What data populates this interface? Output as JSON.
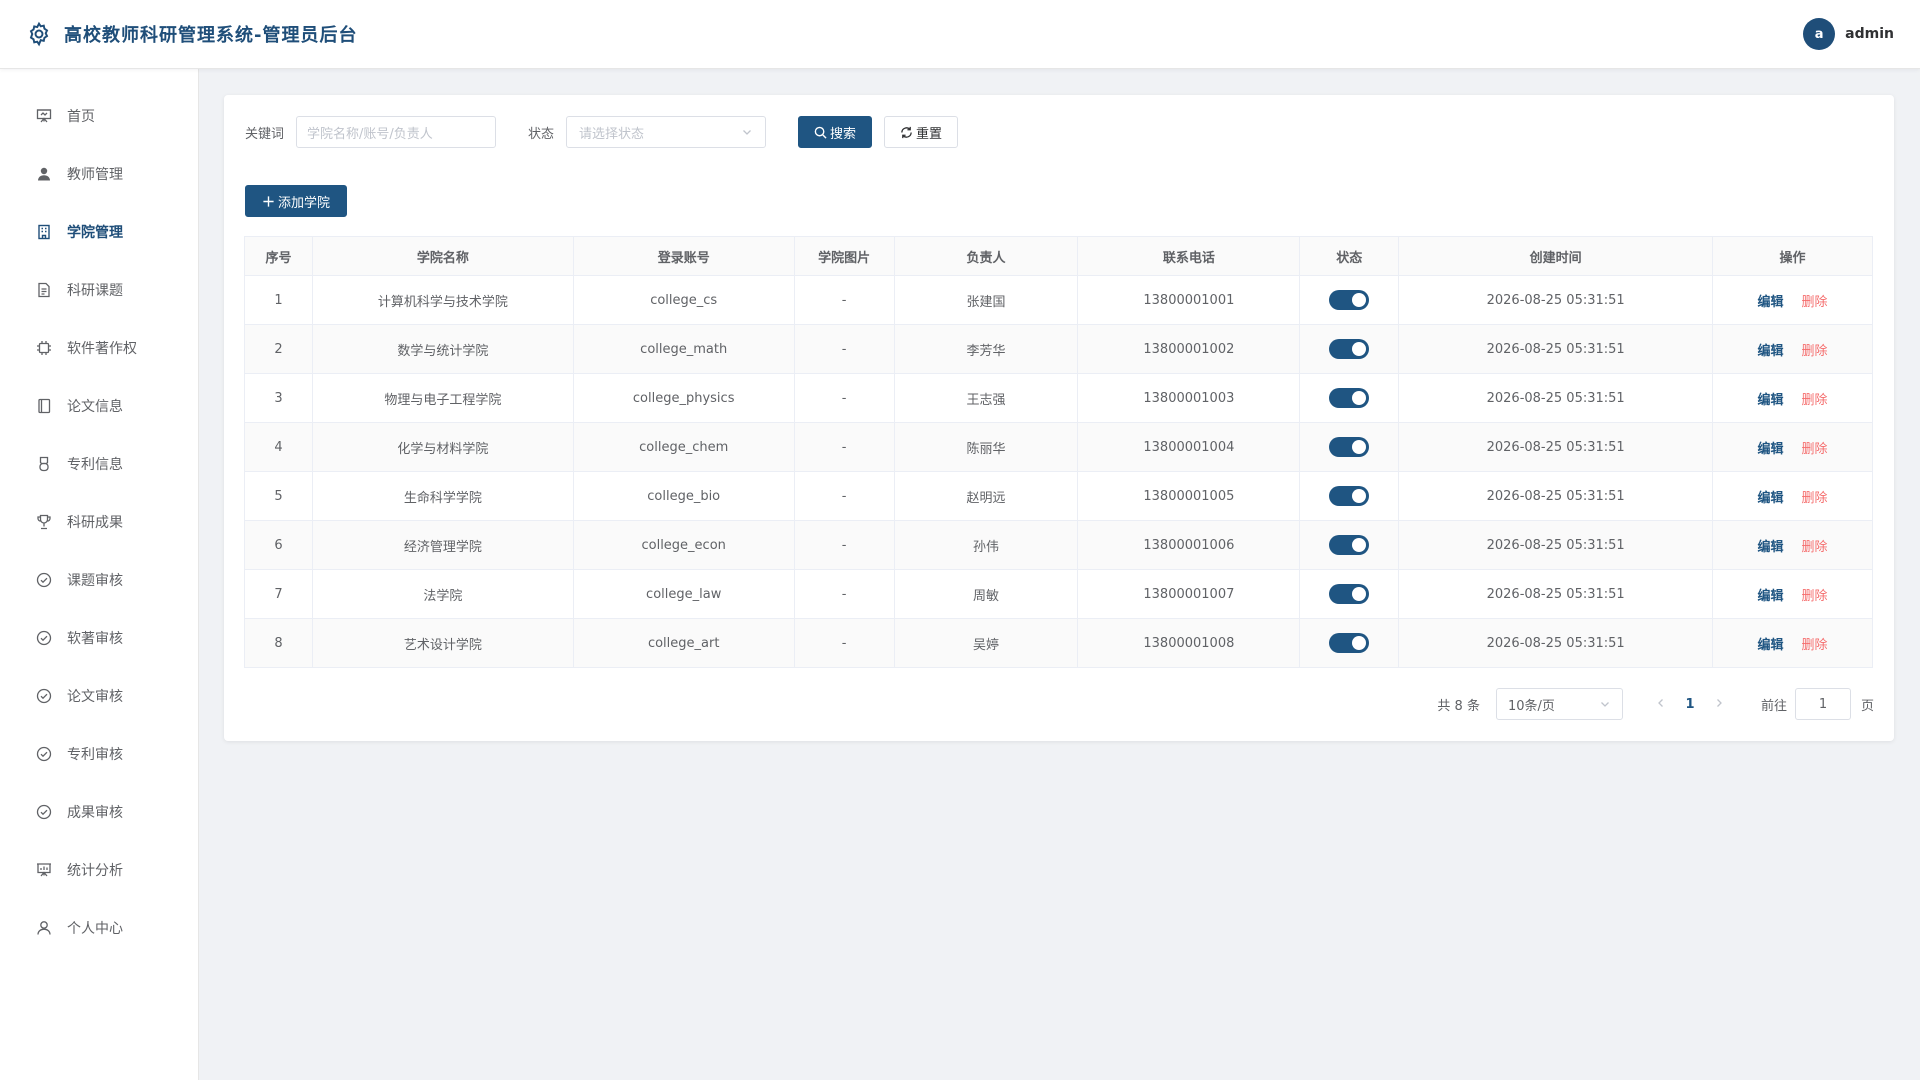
{
  "header": {
    "title": "高校教师科研管理系统-管理员后台",
    "user": {
      "avatar_letter": "a",
      "name": "admin"
    }
  },
  "sidebar": {
    "items": [
      {
        "label": "首页",
        "icon": "presentation-icon",
        "active": false
      },
      {
        "label": "教师管理",
        "icon": "user-icon",
        "active": false
      },
      {
        "label": "学院管理",
        "icon": "building-icon",
        "active": true
      },
      {
        "label": "科研课题",
        "icon": "document-icon",
        "active": false
      },
      {
        "label": "软件著作权",
        "icon": "cpu-icon",
        "active": false
      },
      {
        "label": "论文信息",
        "icon": "notebook-icon",
        "active": false
      },
      {
        "label": "专利信息",
        "icon": "medal-icon",
        "active": false
      },
      {
        "label": "科研成果",
        "icon": "trophy-icon",
        "active": false
      },
      {
        "label": "课题审核",
        "icon": "check-circle-icon",
        "active": false
      },
      {
        "label": "软著审核",
        "icon": "check-circle-icon",
        "active": false
      },
      {
        "label": "论文审核",
        "icon": "check-circle-icon",
        "active": false
      },
      {
        "label": "专利审核",
        "icon": "check-circle-icon",
        "active": false
      },
      {
        "label": "成果审核",
        "icon": "check-circle-icon",
        "active": false
      },
      {
        "label": "统计分析",
        "icon": "data-board-icon",
        "active": false
      },
      {
        "label": "个人中心",
        "icon": "user-outline-icon",
        "active": false
      }
    ]
  },
  "filters": {
    "keyword_label": "关键词",
    "keyword_placeholder": "学院名称/账号/负责人",
    "status_label": "状态",
    "status_placeholder": "请选择状态",
    "search_label": "搜索",
    "reset_label": "重置"
  },
  "actions": {
    "add_label": "添加学院"
  },
  "table": {
    "columns": [
      "序号",
      "学院名称",
      "登录账号",
      "学院图片",
      "负责人",
      "联系电话",
      "状态",
      "创建时间",
      "操作"
    ],
    "edit_label": "编辑",
    "delete_label": "删除",
    "rows": [
      {
        "index": "1",
        "name": "计算机科学与技术学院",
        "account": "college_cs",
        "image": "-",
        "leader": "张建国",
        "phone": "13800001001",
        "status": true,
        "created": "2026-08-25 05:31:51"
      },
      {
        "index": "2",
        "name": "数学与统计学院",
        "account": "college_math",
        "image": "-",
        "leader": "李芳华",
        "phone": "13800001002",
        "status": true,
        "created": "2026-08-25 05:31:51"
      },
      {
        "index": "3",
        "name": "物理与电子工程学院",
        "account": "college_physics",
        "image": "-",
        "leader": "王志强",
        "phone": "13800001003",
        "status": true,
        "created": "2026-08-25 05:31:51"
      },
      {
        "index": "4",
        "name": "化学与材料学院",
        "account": "college_chem",
        "image": "-",
        "leader": "陈丽华",
        "phone": "13800001004",
        "status": true,
        "created": "2026-08-25 05:31:51"
      },
      {
        "index": "5",
        "name": "生命科学学院",
        "account": "college_bio",
        "image": "-",
        "leader": "赵明远",
        "phone": "13800001005",
        "status": true,
        "created": "2026-08-25 05:31:51"
      },
      {
        "index": "6",
        "name": "经济管理学院",
        "account": "college_econ",
        "image": "-",
        "leader": "孙伟",
        "phone": "13800001006",
        "status": true,
        "created": "2026-08-25 05:31:51"
      },
      {
        "index": "7",
        "name": "法学院",
        "account": "college_law",
        "image": "-",
        "leader": "周敏",
        "phone": "13800001007",
        "status": true,
        "created": "2026-08-25 05:31:51"
      },
      {
        "index": "8",
        "name": "艺术设计学院",
        "account": "college_art",
        "image": "-",
        "leader": "吴婷",
        "phone": "13800001008",
        "status": true,
        "created": "2026-08-25 05:31:51"
      }
    ]
  },
  "pagination": {
    "total_text": "共 8 条",
    "page_size": "10条/页",
    "current_page": "1",
    "goto_label": "前往",
    "goto_value": "1",
    "page_suffix": "页"
  },
  "colors": {
    "primary": "#1f5582",
    "danger": "#f56c6c",
    "title": "#1f4e79"
  }
}
